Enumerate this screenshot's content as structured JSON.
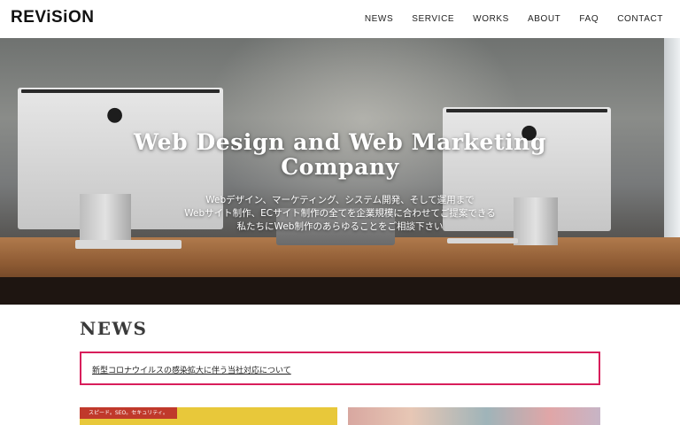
{
  "header": {
    "logo": "REViSiON",
    "nav": [
      "NEWS",
      "SERVICE",
      "WORKS",
      "ABOUT",
      "FAQ",
      "CONTACT"
    ]
  },
  "hero": {
    "title_line1": "Web Design and Web Marketing",
    "title_line2": "Company",
    "subtitle_line1": "Webデザイン、マーケティング、システム開発、そして運用まで",
    "subtitle_line2": "Webサイト制作、ECサイト制作の全てを企業規模に合わせてご提案できる",
    "subtitle_line3": "私たちにWeb制作のあらゆることをご相談下さい"
  },
  "news": {
    "heading": "NEWS",
    "item": "新型コロナウイルスの感染拡大に伴う当社対応について",
    "accent": "#d81e5b"
  },
  "cards": {
    "left_label": "スピード。SEO。セキュリティ。"
  }
}
